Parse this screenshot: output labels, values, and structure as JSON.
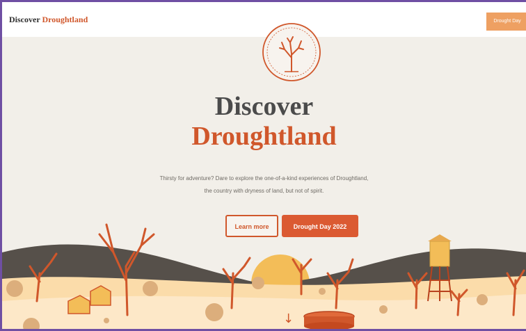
{
  "navbar": {
    "brand_part1": "Discover",
    "brand_part2": "Droughtland",
    "cta_label": "Drought Day"
  },
  "hero": {
    "title_line1": "Discover",
    "title_line2": "Droughtland",
    "tagline_line1": "Thirsty for adventure? Dare to explore the one-of-a-kind experiences of Droughtland,",
    "tagline_line2": "the country with dryness of land, but not of spirit.",
    "primary_button": "Learn more",
    "secondary_button": "Drought Day 2022"
  },
  "icons": {
    "emblem": "dead-tree-emblem-icon",
    "scroll": "down-arrow-icon"
  },
  "colors": {
    "accent": "#d0572b",
    "accent_light": "#eea062",
    "background": "#f2efe9",
    "hills": "#56504a",
    "sun": "#f3bd58",
    "ground": "#fce6c2"
  }
}
